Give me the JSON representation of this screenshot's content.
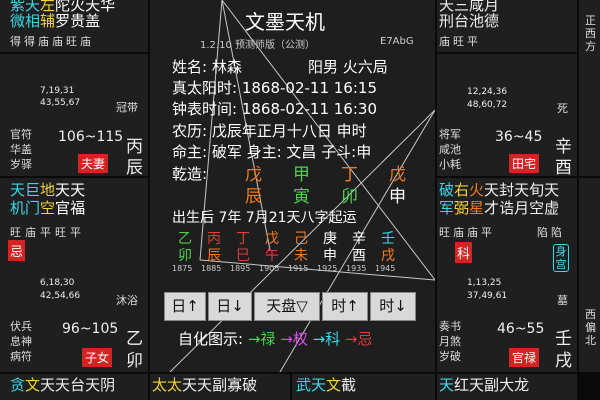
{
  "app": {
    "title": "文墨天机",
    "version": "1.2.10 预测师版（公测）",
    "code": "E7AbG"
  },
  "person": {
    "name_line": "姓名: 林森",
    "sex_line": "阳男 火六局",
    "solar_time": "真太阳时: 1868-02-11   16:15",
    "clock_time": "钟表时间: 1868-02-11   16:30",
    "lunar": "农历: 戊辰年正月十八日 申时",
    "life": "命主: 破军 身主: 文昌 子斗:申",
    "bazi_label": "乾造:",
    "bazi_stems": [
      "戊",
      "甲",
      "丁",
      "戊"
    ],
    "bazi_branches": [
      "辰",
      "寅",
      "卯",
      "申"
    ],
    "qiyun": "出生后 7年 7月21天八字起运"
  },
  "dayun": {
    "stems": [
      "乙",
      "丙",
      "丁",
      "戊",
      "己",
      "庚",
      "辛",
      "壬"
    ],
    "branches": [
      "卯",
      "辰",
      "巳",
      "午",
      "未",
      "申",
      "酉",
      "戌"
    ],
    "ages": [
      "1875",
      "1885",
      "1895",
      "1905",
      "1915",
      "1925",
      "1935",
      "1945"
    ]
  },
  "buttons": {
    "day_up": "日↑",
    "day_down": "日↓",
    "tianpan": "天盘▽",
    "hour_up": "时↑",
    "hour_down": "时↓"
  },
  "legend": {
    "label": "自化图示:",
    "lu": "→禄",
    "quan": "→权",
    "ke": "→科",
    "ji": "→忌"
  },
  "palaces": {
    "top_left": {
      "stars": [
        "紫",
        "天",
        "左",
        "陀",
        "火",
        "天",
        "华"
      ],
      "stars2": [
        "微",
        "相",
        "辅",
        "罗",
        "贵",
        "盖"
      ],
      "status": "得得庙庙旺庙"
    },
    "mid_left1": {
      "years1": "7,19,31",
      "years2": "43,55,67",
      "phase": "冠带",
      "god1": "官符",
      "god2": "华盖",
      "god3": "岁驿",
      "range": "106~115",
      "gan": "丙",
      "zhi": "辰",
      "name": "夫妻"
    },
    "mid_left2": {
      "stars": [
        "天",
        "巨",
        "地",
        "天",
        "天"
      ],
      "stars2": [
        "机",
        "门",
        "空",
        "官",
        "福"
      ],
      "status": "旺庙平旺平",
      "tag": "忌",
      "years1": "6,18,30",
      "years2": "42,54,66",
      "phase": "沐浴",
      "god1": "伏兵",
      "god2": "息神",
      "god3": "病符",
      "range": "96~105",
      "gan": "乙",
      "zhi": "卯",
      "name": "子女"
    },
    "top_right": {
      "stars": [
        "天",
        "三",
        "咸",
        "月"
      ],
      "stars2": [
        "刑",
        "台",
        "池",
        "德"
      ],
      "status": "庙旺平",
      "dir": "正西方"
    },
    "mid_right1": {
      "years1": "12,24,36",
      "years2": "48,60,72",
      "phase": "死",
      "god1": "将军",
      "god2": "咸池",
      "god3": "小耗",
      "range": "36~45",
      "gan": "辛",
      "zhi": "酉",
      "name": "田宅"
    },
    "mid_right2": {
      "stars": [
        "破",
        "右",
        "火",
        "天",
        "封",
        "天",
        "旬",
        "天"
      ],
      "stars2": [
        "军",
        "弼",
        "星",
        "才",
        "诰",
        "月",
        "空",
        "虚"
      ],
      "status": "旺庙庙平",
      "status2": "陷陷",
      "tag": "科",
      "shen": "身宫",
      "years1": "1,13,25",
      "years2": "37,49,61",
      "phase": "墓",
      "god1": "奏书",
      "god2": "月煞",
      "god3": "岁破",
      "range": "46~55",
      "gan": "壬",
      "zhi": "戌",
      "name": "官禄",
      "dir": "西偏北"
    },
    "bottom": [
      {
        "stars": [
          "贪",
          "文",
          "天",
          "天",
          "台",
          "天",
          "阴"
        ]
      },
      {
        "stars": [
          "太",
          "太",
          "天",
          "天",
          "副",
          "寡",
          "破"
        ]
      },
      {
        "stars": [
          "武",
          "天",
          "文",
          "截"
        ]
      },
      {
        "stars": [
          "天",
          "红",
          "天",
          "副",
          "大",
          "龙"
        ]
      }
    ]
  }
}
